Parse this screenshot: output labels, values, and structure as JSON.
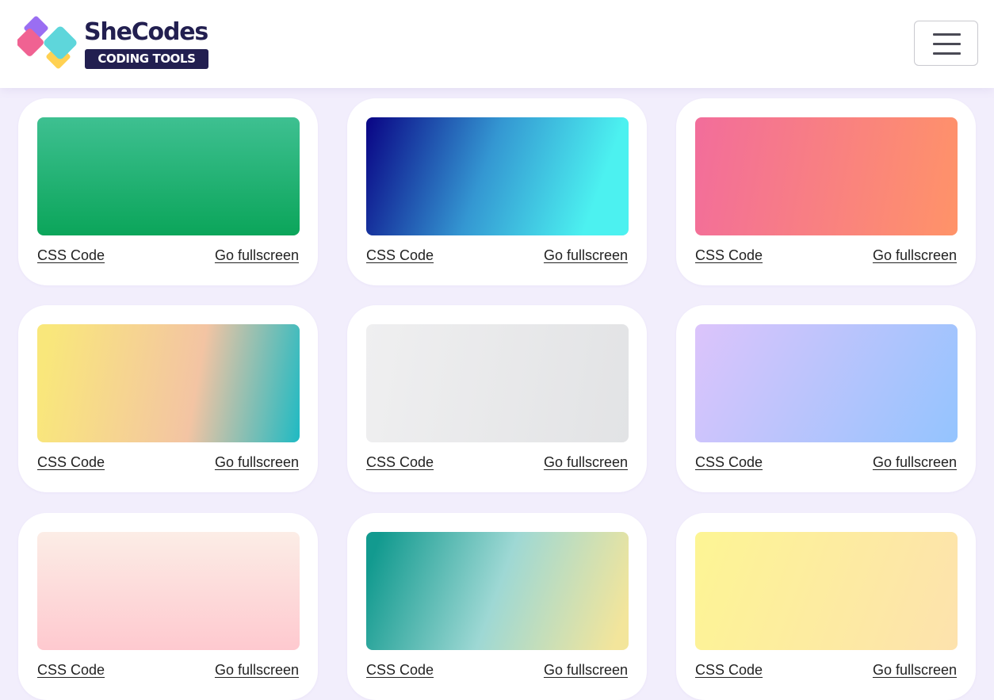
{
  "brand": {
    "name": "SheCodes",
    "badge": "CODING TOOLS"
  },
  "header": {
    "menu_icon": "hamburger-menu-icon"
  },
  "cards": [
    {
      "css_label": "CSS Code",
      "fullscreen_label": "Go fullscreen",
      "colors": [
        "#3ec091",
        "#0ba55a"
      ]
    },
    {
      "css_label": "CSS Code",
      "fullscreen_label": "Go fullscreen",
      "colors": [
        "#0b0a88",
        "#3497d2",
        "#4cf1f0"
      ]
    },
    {
      "css_label": "CSS Code",
      "fullscreen_label": "Go fullscreen",
      "colors": [
        "#f26d9b",
        "#ff9368"
      ]
    },
    {
      "css_label": "CSS Code",
      "fullscreen_label": "Go fullscreen",
      "colors": [
        "#f9e77b",
        "#f3c4a3",
        "#1fbac3"
      ]
    },
    {
      "css_label": "CSS Code",
      "fullscreen_label": "Go fullscreen",
      "colors": [
        "#efeff0",
        "#e2e3e5"
      ]
    },
    {
      "css_label": "CSS Code",
      "fullscreen_label": "Go fullscreen",
      "colors": [
        "#dcc4fb",
        "#94c4fe"
      ]
    },
    {
      "css_label": "CSS Code",
      "fullscreen_label": "Go fullscreen",
      "colors": [
        "#fcede6",
        "#fec9cf"
      ]
    },
    {
      "css_label": "CSS Code",
      "fullscreen_label": "Go fullscreen",
      "colors": [
        "#129a8f",
        "#9ed8d4",
        "#f3e59b"
      ]
    },
    {
      "css_label": "CSS Code",
      "fullscreen_label": "Go fullscreen",
      "colors": [
        "#fdf594",
        "#fde2ad"
      ]
    }
  ]
}
